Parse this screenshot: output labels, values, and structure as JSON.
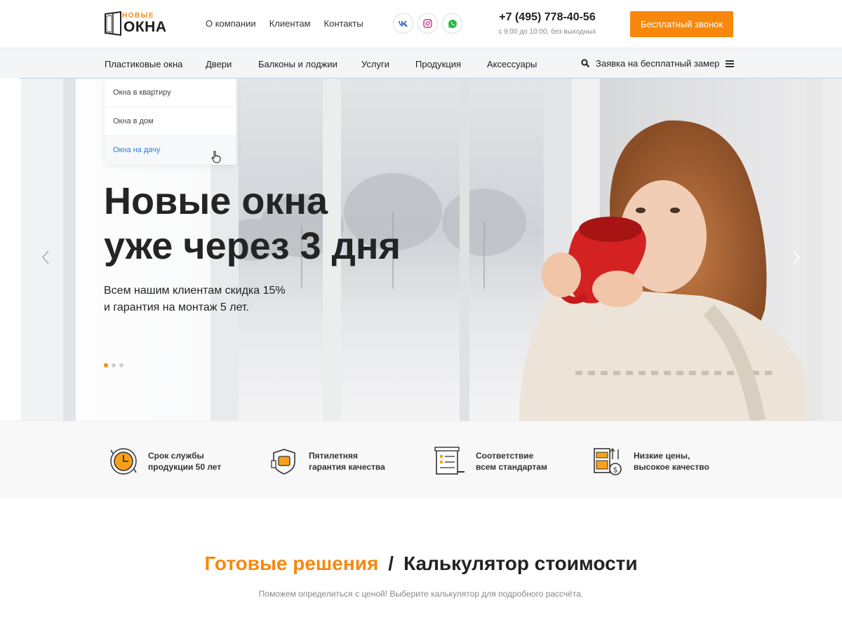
{
  "header": {
    "logo_small": "НОВЫЕ",
    "logo_big": "ОКНА",
    "nav": [
      "О компании",
      "Клиентам",
      "Контакты"
    ],
    "socials": [
      "vk-icon",
      "instagram-icon",
      "whatsapp-icon"
    ],
    "phone": "+7 (495) 778-40-56",
    "hours": "с 9:00 до 10:00, без выходных",
    "call_button": "Бесплатный звонок"
  },
  "main_nav": {
    "items": [
      "Пластиковые окна",
      "Двери",
      "Балконы и лоджии",
      "Услуги",
      "Продукция",
      "Аксессуары"
    ],
    "measure_link": "Заявка на бесплатный замер"
  },
  "dropdown": {
    "items": [
      "Окна в квартиру",
      "Окна в дом",
      "Окна на дачу"
    ],
    "active_index": 2
  },
  "hero": {
    "title_line1": "Новые окна",
    "title_line2": "уже через 3 дня",
    "subtitle_line1": "Всем нашим клиентам скидка 15%",
    "subtitle_line2": "и гарантия на монтаж  5 лет.",
    "slide_count": 3,
    "active_slide": 1
  },
  "features": [
    {
      "icon": "clock-icon",
      "line1": "Срок службы",
      "line2": "продукции 50 лет"
    },
    {
      "icon": "shield-thumb-icon",
      "line1": "Пятилетняя",
      "line2": "гарантия качества"
    },
    {
      "icon": "checklist-icon",
      "line1": "Соответствие",
      "line2": "всем стандартам"
    },
    {
      "icon": "price-icon",
      "line1": "Низкие цены,",
      "line2": "высокое качество"
    }
  ],
  "section": {
    "title_orange": "Готовые решения",
    "separator": "/",
    "title_dark": "Калькулятор стоимости",
    "subtitle": "Поможем определиться с ценой! Выберите калькулятор для подробного рассчёта."
  },
  "colors": {
    "accent": "#f7880d",
    "link_active": "#2a7fd4",
    "text": "#222222"
  }
}
